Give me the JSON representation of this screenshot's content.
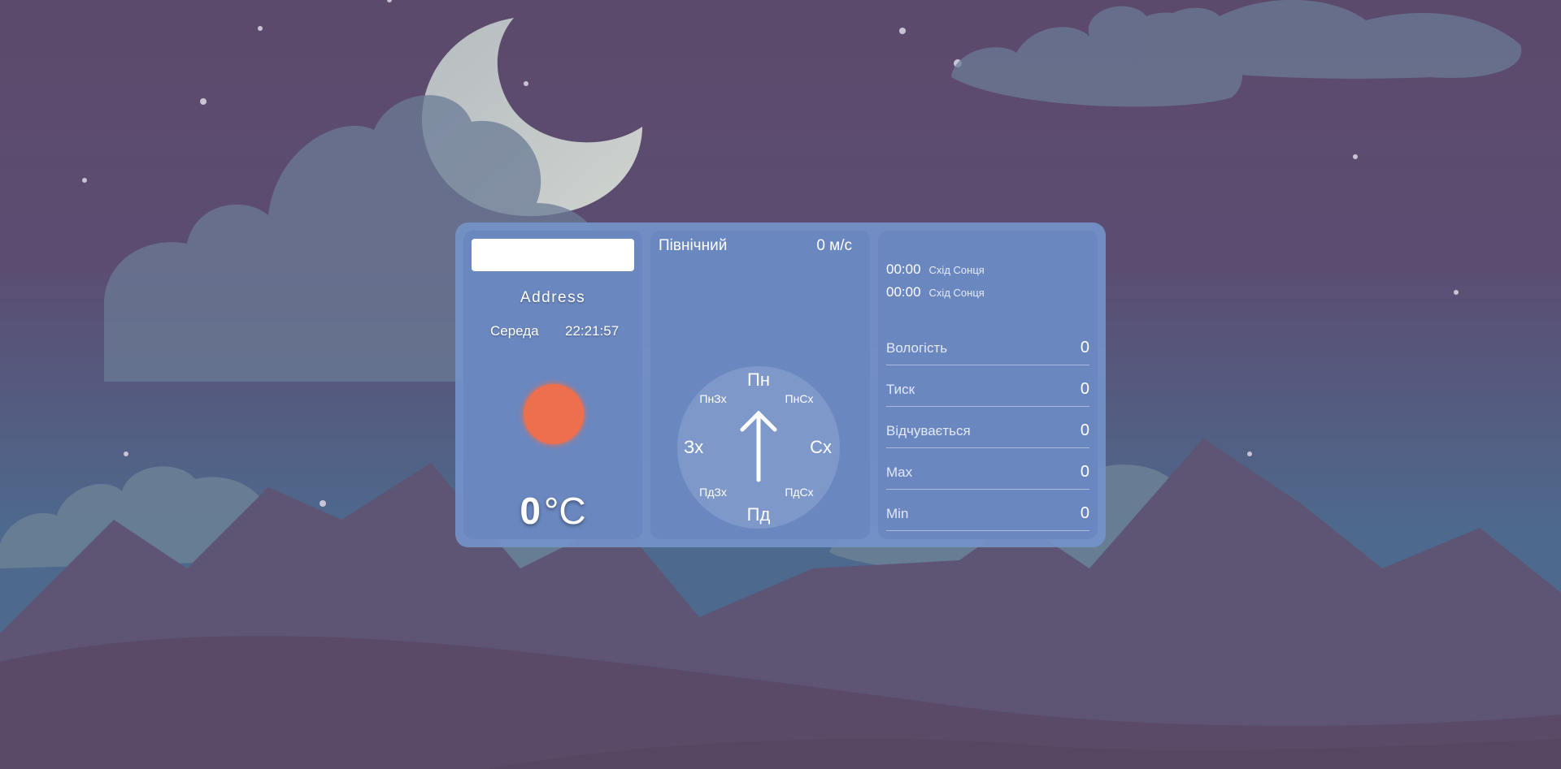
{
  "search": {
    "value": "",
    "placeholder": ""
  },
  "location": {
    "address": "Address",
    "day": "Середа",
    "time": "22:21:57"
  },
  "current": {
    "icon": "sun-icon",
    "temperature": "0",
    "unit": "°C"
  },
  "wind": {
    "direction_name": "Північний",
    "speed": "0 м/с",
    "compass": {
      "n": "Пн",
      "ne": "ПнСх",
      "e": "Сх",
      "se": "ПдСх",
      "s": "Пд",
      "sw": "ПдЗх",
      "w": "Зх",
      "nw": "ПнЗх"
    },
    "arrow_icon": "arrow-up-icon"
  },
  "sun": [
    {
      "time": "00:00",
      "label": "Схід Сонця"
    },
    {
      "time": "00:00",
      "label": "Схід Сонця"
    }
  ],
  "stats": [
    {
      "label": "Вологість",
      "value": "0"
    },
    {
      "label": "Тиск",
      "value": "0"
    },
    {
      "label": "Відчувається",
      "value": "0"
    },
    {
      "label": "Max",
      "value": "0"
    },
    {
      "label": "Min",
      "value": "0"
    }
  ],
  "colors": {
    "card": "#7492c8",
    "panel": "#6886be",
    "sun_icon": "#ee6f4d",
    "text": "#ffffff"
  }
}
